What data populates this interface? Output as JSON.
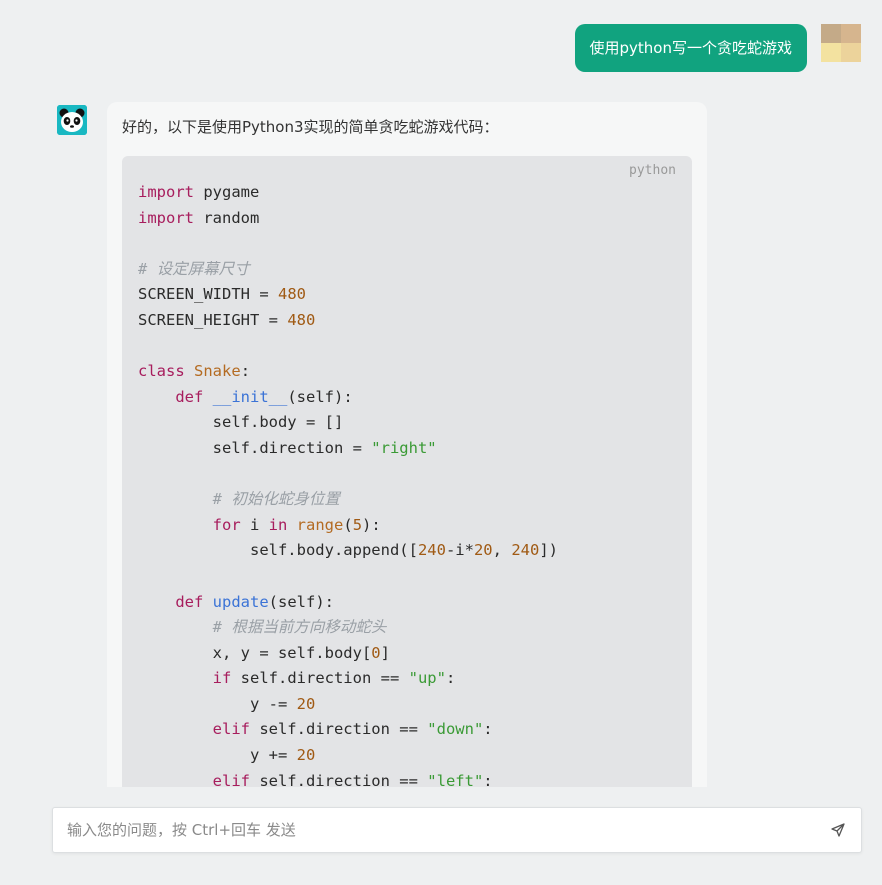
{
  "user_message": {
    "text": "使用python写一个贪吃蛇游戏"
  },
  "bot_message": {
    "intro": "好的，以下是使用Python3实现的简单贪吃蛇游戏代码：",
    "code_language": "python",
    "code_lines": [
      [
        [
          "kw",
          "import"
        ],
        [
          "txt",
          " pygame"
        ]
      ],
      [
        [
          "kw",
          "import"
        ],
        [
          "txt",
          " random"
        ]
      ],
      [],
      [
        [
          "com",
          "# 设定屏幕尺寸"
        ]
      ],
      [
        [
          "txt",
          "SCREEN_WIDTH = "
        ],
        [
          "num",
          "480"
        ]
      ],
      [
        [
          "txt",
          "SCREEN_HEIGHT = "
        ],
        [
          "num",
          "480"
        ]
      ],
      [],
      [
        [
          "kw",
          "class"
        ],
        [
          "txt",
          " "
        ],
        [
          "cls",
          "Snake"
        ],
        [
          "txt",
          ":"
        ]
      ],
      [
        [
          "txt",
          "    "
        ],
        [
          "kw",
          "def"
        ],
        [
          "txt",
          " "
        ],
        [
          "fn",
          "__init__"
        ],
        [
          "txt",
          "(self):"
        ]
      ],
      [
        [
          "txt",
          "        self.body = []"
        ]
      ],
      [
        [
          "txt",
          "        self.direction = "
        ],
        [
          "str",
          "\"right\""
        ]
      ],
      [],
      [
        [
          "txt",
          "        "
        ],
        [
          "com",
          "# 初始化蛇身位置"
        ]
      ],
      [
        [
          "txt",
          "        "
        ],
        [
          "kw",
          "for"
        ],
        [
          "txt",
          " i "
        ],
        [
          "kw",
          "in"
        ],
        [
          "txt",
          " "
        ],
        [
          "cls",
          "range"
        ],
        [
          "txt",
          "("
        ],
        [
          "num",
          "5"
        ],
        [
          "txt",
          "):"
        ]
      ],
      [
        [
          "txt",
          "            self.body.append(["
        ],
        [
          "num",
          "240"
        ],
        [
          "txt",
          "-i*"
        ],
        [
          "num",
          "20"
        ],
        [
          "txt",
          ", "
        ],
        [
          "num",
          "240"
        ],
        [
          "txt",
          "])"
        ]
      ],
      [],
      [
        [
          "txt",
          "    "
        ],
        [
          "kw",
          "def"
        ],
        [
          "txt",
          " "
        ],
        [
          "fn",
          "update"
        ],
        [
          "txt",
          "(self):"
        ]
      ],
      [
        [
          "txt",
          "        "
        ],
        [
          "com",
          "# 根据当前方向移动蛇头"
        ]
      ],
      [
        [
          "txt",
          "        x, y = self.body["
        ],
        [
          "num",
          "0"
        ],
        [
          "txt",
          "]"
        ]
      ],
      [
        [
          "txt",
          "        "
        ],
        [
          "kw",
          "if"
        ],
        [
          "txt",
          " self.direction == "
        ],
        [
          "str",
          "\"up\""
        ],
        [
          "txt",
          ":"
        ]
      ],
      [
        [
          "txt",
          "            y -= "
        ],
        [
          "num",
          "20"
        ]
      ],
      [
        [
          "txt",
          "        "
        ],
        [
          "kw",
          "elif"
        ],
        [
          "txt",
          " self.direction == "
        ],
        [
          "str",
          "\"down\""
        ],
        [
          "txt",
          ":"
        ]
      ],
      [
        [
          "txt",
          "            y += "
        ],
        [
          "num",
          "20"
        ]
      ],
      [
        [
          "txt",
          "        "
        ],
        [
          "kw",
          "elif"
        ],
        [
          "txt",
          " self.direction == "
        ],
        [
          "str",
          "\"left\""
        ],
        [
          "txt",
          ":"
        ]
      ]
    ]
  },
  "input": {
    "placeholder": "输入您的问题，按 Ctrl+回车 发送",
    "value": ""
  },
  "send_icon": "send-icon",
  "colors": {
    "accent": "#11a37f",
    "keyword": "#a71d5d",
    "class_name": "#b46b22",
    "function_name": "#3b73d6",
    "number": "#a05a14",
    "string": "#3a9a35",
    "comment": "#9aa0a6"
  }
}
